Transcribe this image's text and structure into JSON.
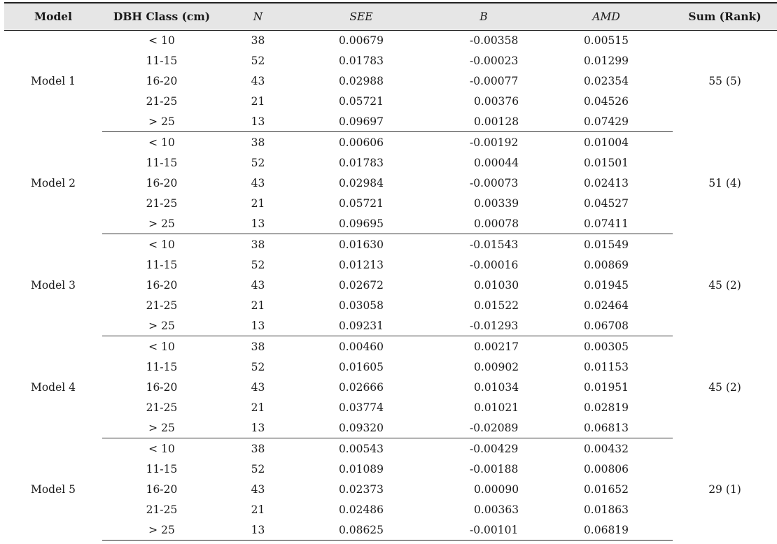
{
  "headers": [
    "Model",
    "DBH Class (cm)",
    "N",
    "SEE",
    "B",
    "AMD",
    "Sum (Rank)"
  ],
  "groups": [
    {
      "model": "Model 1",
      "sum_rank": "55 (5)",
      "rows": [
        {
          "dbh": "< 10",
          "n": "38",
          "see": "0.00679",
          "b": "-0.00358",
          "amd": "0.00515"
        },
        {
          "dbh": "11-15",
          "n": "52",
          "see": "0.01783",
          "b": "-0.00023",
          "amd": "0.01299"
        },
        {
          "dbh": "16-20",
          "n": "43",
          "see": "0.02988",
          "b": "-0.00077",
          "amd": "0.02354"
        },
        {
          "dbh": "21-25",
          "n": "21",
          "see": "0.05721",
          "b": "0.00376",
          "amd": "0.04526"
        },
        {
          "dbh": "> 25",
          "n": "13",
          "see": "0.09697",
          "b": "0.00128",
          "amd": "0.07429"
        }
      ]
    },
    {
      "model": "Model 2",
      "sum_rank": "51 (4)",
      "rows": [
        {
          "dbh": "< 10",
          "n": "38",
          "see": "0.00606",
          "b": "-0.00192",
          "amd": "0.01004"
        },
        {
          "dbh": "11-15",
          "n": "52",
          "see": "0.01783",
          "b": "0.00044",
          "amd": "0.01501"
        },
        {
          "dbh": "16-20",
          "n": "43",
          "see": "0.02984",
          "b": "-0.00073",
          "amd": "0.02413"
        },
        {
          "dbh": "21-25",
          "n": "21",
          "see": "0.05721",
          "b": "0.00339",
          "amd": "0.04527"
        },
        {
          "dbh": "> 25",
          "n": "13",
          "see": "0.09695",
          "b": "0.00078",
          "amd": "0.07411"
        }
      ]
    },
    {
      "model": "Model 3",
      "sum_rank": "45 (2)",
      "rows": [
        {
          "dbh": "< 10",
          "n": "38",
          "see": "0.01630",
          "b": "-0.01543",
          "amd": "0.01549"
        },
        {
          "dbh": "11-15",
          "n": "52",
          "see": "0.01213",
          "b": "-0.00016",
          "amd": "0.00869"
        },
        {
          "dbh": "16-20",
          "n": "43",
          "see": "0.02672",
          "b": "0.01030",
          "amd": "0.01945"
        },
        {
          "dbh": "21-25",
          "n": "21",
          "see": "0.03058",
          "b": "0.01522",
          "amd": "0.02464"
        },
        {
          "dbh": "> 25",
          "n": "13",
          "see": "0.09231",
          "b": "-0.01293",
          "amd": "0.06708"
        }
      ]
    },
    {
      "model": "Model 4",
      "sum_rank": "45 (2)",
      "rows": [
        {
          "dbh": "< 10",
          "n": "38",
          "see": "0.00460",
          "b": "0.00217",
          "amd": "0.00305"
        },
        {
          "dbh": "11-15",
          "n": "52",
          "see": "0.01605",
          "b": "0.00902",
          "amd": "0.01153"
        },
        {
          "dbh": "16-20",
          "n": "43",
          "see": "0.02666",
          "b": "0.01034",
          "amd": "0.01951"
        },
        {
          "dbh": "21-25",
          "n": "21",
          "see": "0.03774",
          "b": "0.01021",
          "amd": "0.02819"
        },
        {
          "dbh": "> 25",
          "n": "13",
          "see": "0.09320",
          "b": "-0.02089",
          "amd": "0.06813"
        }
      ]
    },
    {
      "model": "Model 5",
      "sum_rank": "29 (1)",
      "rows": [
        {
          "dbh": "< 10",
          "n": "38",
          "see": "0.00543",
          "b": "-0.00429",
          "amd": "0.00432"
        },
        {
          "dbh": "11-15",
          "n": "52",
          "see": "0.01089",
          "b": "-0.00188",
          "amd": "0.00806"
        },
        {
          "dbh": "16-20",
          "n": "43",
          "see": "0.02373",
          "b": "0.00090",
          "amd": "0.01652"
        },
        {
          "dbh": "21-25",
          "n": "21",
          "see": "0.02486",
          "b": "0.00363",
          "amd": "0.01863"
        },
        {
          "dbh": "> 25",
          "n": "13",
          "see": "0.08625",
          "b": "-0.00101",
          "amd": "0.06819"
        }
      ]
    }
  ]
}
